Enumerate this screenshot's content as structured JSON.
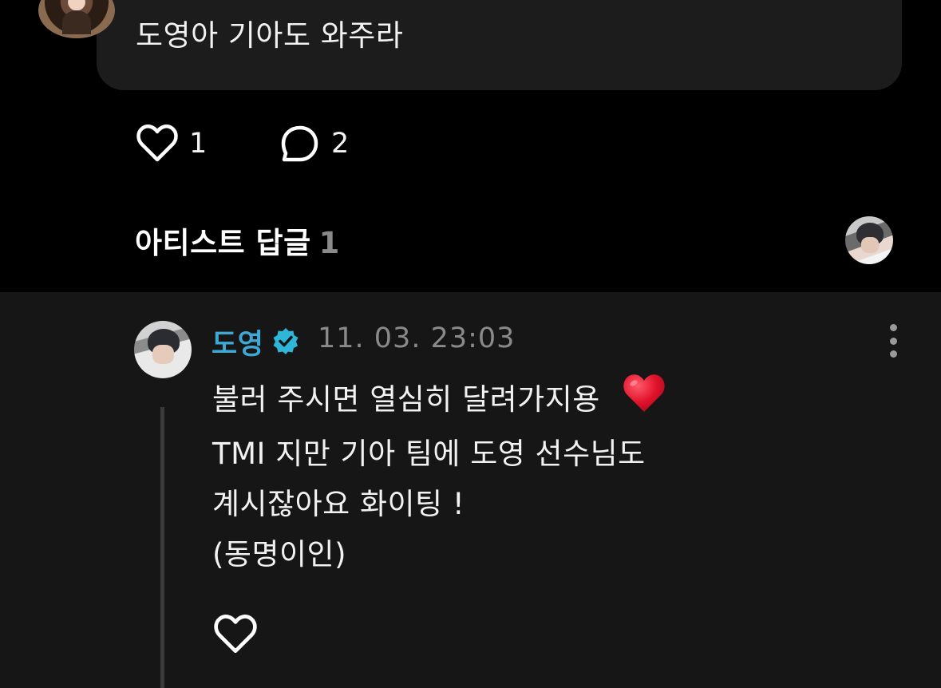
{
  "comment": {
    "text": "도영아 기아도 와주라",
    "like_count": "1",
    "reply_count": "2"
  },
  "artist_replies": {
    "title": "아티스트 답글",
    "count": "1"
  },
  "reply": {
    "author": "도영",
    "timestamp": "11. 03. 23:03",
    "lines": [
      "불러 주시면 열심히 달려가지용",
      "TMI 지만 기아 팀에 도영 선수님도",
      "계시잖아요 화이팅 !",
      "(동명이인)"
    ],
    "emoji": "red-heart-emoji"
  },
  "icons": {
    "like": "heart-outline-icon",
    "reply": "speech-bubble-icon",
    "verified": "verified-badge-icon",
    "more": "more-vertical-icon"
  },
  "colors": {
    "background": "#000000",
    "bubble": "#1c1c1c",
    "reply_panel": "#161616",
    "artist_name": "#3fa9d6",
    "verified_badge": "#2fb5d8",
    "muted": "#8a8a8a",
    "heart_emoji": "#e0132b"
  }
}
